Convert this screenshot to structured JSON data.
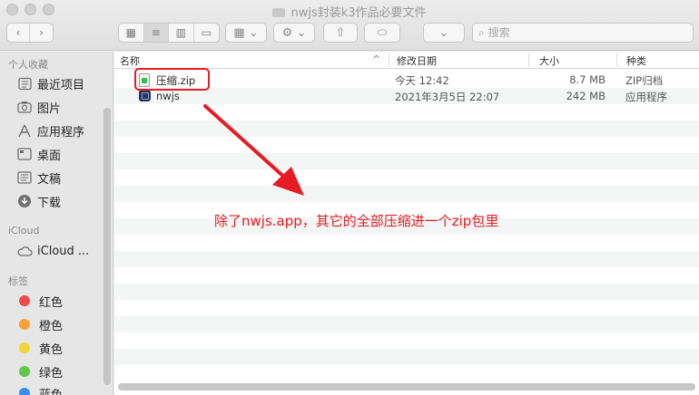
{
  "window": {
    "title": "nwjs封装k3作品必要文件"
  },
  "toolbar": {
    "back_icon": "chevron-left-icon",
    "forward_icon": "chevron-right-icon",
    "search_placeholder": "搜索"
  },
  "sidebar": {
    "favorites_header": "个人收藏",
    "favorites": [
      {
        "label": "最近项目",
        "icon": "clock-icon"
      },
      {
        "label": "图片",
        "icon": "camera-icon"
      },
      {
        "label": "应用程序",
        "icon": "apps-icon"
      },
      {
        "label": "桌面",
        "icon": "desktop-icon"
      },
      {
        "label": "文稿",
        "icon": "document-icon"
      },
      {
        "label": "下载",
        "icon": "download-icon"
      }
    ],
    "icloud_header": "iCloud",
    "icloud_item": "iCloud ...",
    "tags_header": "标签",
    "tags": [
      {
        "label": "红色",
        "color": "#f0494b"
      },
      {
        "label": "橙色",
        "color": "#f7a03a"
      },
      {
        "label": "黄色",
        "color": "#f4d536"
      },
      {
        "label": "绿色",
        "color": "#5dca4a"
      },
      {
        "label": "蓝色",
        "color": "#3a8ef0"
      }
    ]
  },
  "columns": {
    "name": "名称",
    "modified": "修改日期",
    "size": "大小",
    "kind": "种类"
  },
  "files": [
    {
      "name": "压缩.zip",
      "modified": "今天 12:42",
      "size": "8.7 MB",
      "kind": "ZIP归档"
    },
    {
      "name": "nwjs",
      "modified": "2021年3月5日 22:07",
      "size": "242 MB",
      "kind": "应用程序"
    }
  ],
  "annotation": {
    "text": "除了nwjs.app，其它的全部压缩进一个zip包里",
    "color": "#e51c23"
  }
}
